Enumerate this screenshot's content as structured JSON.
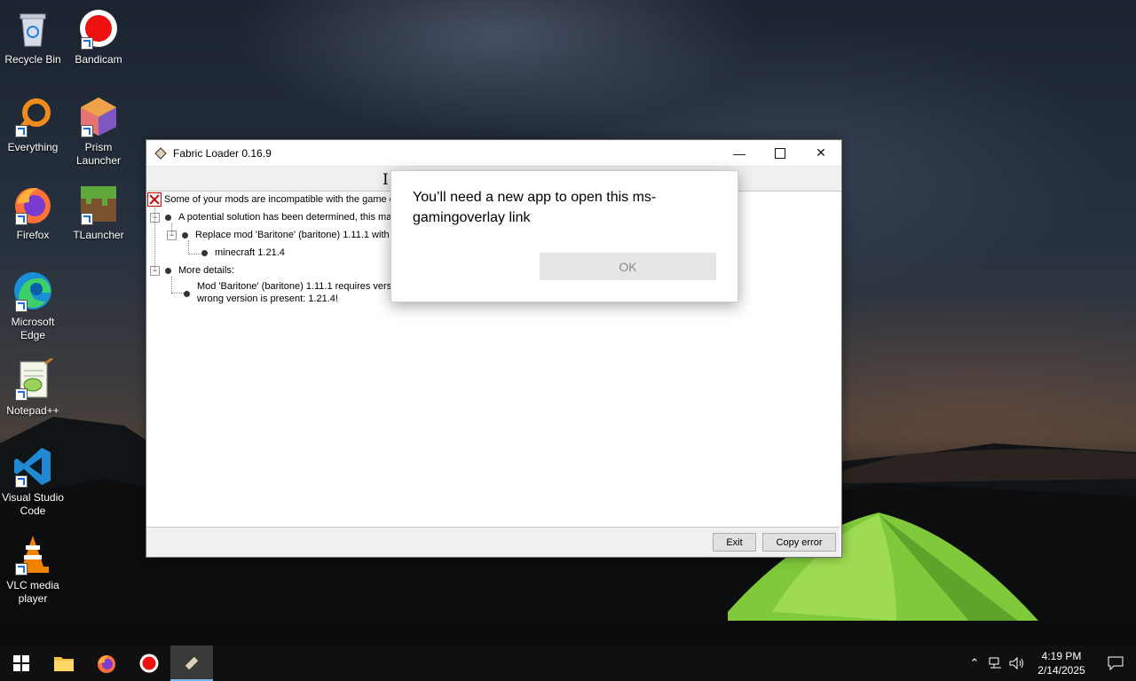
{
  "desktop": {
    "icons": [
      {
        "label": "Recycle Bin"
      },
      {
        "label": "Bandicam"
      },
      {
        "label": "Everything"
      },
      {
        "label": "Prism Launcher"
      },
      {
        "label": "Firefox"
      },
      {
        "label": "TLauncher"
      },
      {
        "label": "Microsoft Edge"
      },
      {
        "label": "Notepad++"
      },
      {
        "label": "Visual Studio Code"
      },
      {
        "label": "VLC media player"
      }
    ]
  },
  "fabric_window": {
    "title": "Fabric Loader 0.16.9",
    "tree": {
      "root": "Some of your mods are incompatible with the game or each other!",
      "solution_header": "A potential solution has been determined, this may resolve your problem:",
      "solution_item": "Replace mod 'Baritone' (baritone) 1.11.1 with any version that is compatible with:",
      "solution_sub": "minecraft 1.21.4",
      "details_header": "More details:",
      "details_item_line1": "Mod 'Baritone' (baritone) 1.11.1 requires version 1.21.3 of 'Minecraft' (minecraft), but only the",
      "details_item_line2": "wrong version is present: 1.21.4!"
    },
    "buttons": {
      "exit": "Exit",
      "copy_error": "Copy error"
    }
  },
  "dialog": {
    "message": "You’ll need a new app to open this ms-gamingoverlay link",
    "ok": "OK"
  },
  "taskbar": {
    "clock_time": "4:19 PM",
    "clock_date": "2/14/2025"
  }
}
